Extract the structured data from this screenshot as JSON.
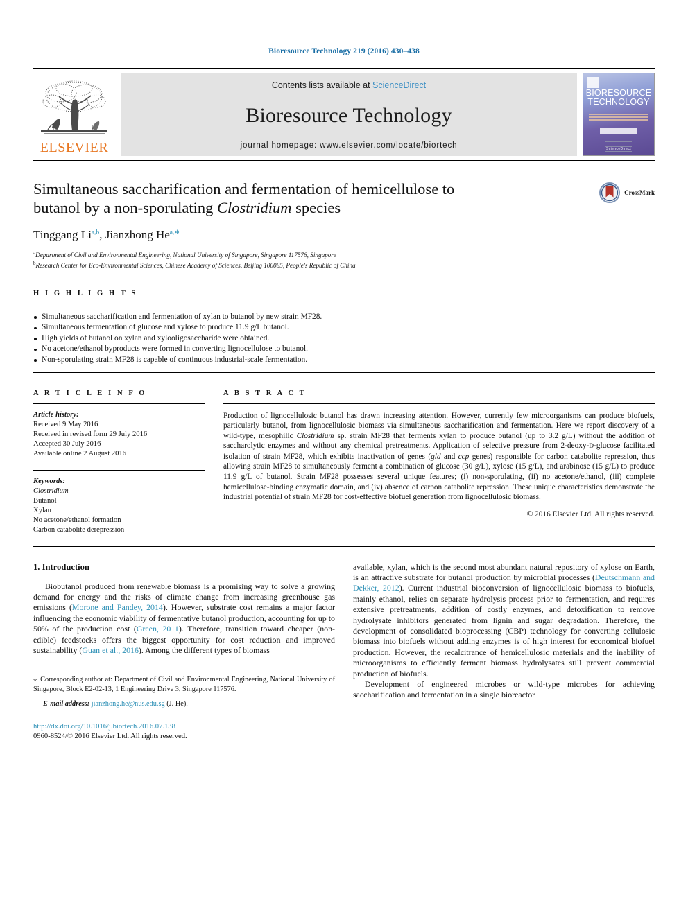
{
  "running_head": "Bioresource Technology 219 (2016) 430–438",
  "masthead": {
    "publisher_logo_text": "ELSEVIER",
    "contents_prefix": "Contents lists available at ",
    "contents_link": "ScienceDirect",
    "journal_name": "Bioresource Technology",
    "homepage_label": "journal homepage: www.elsevier.com/locate/biortech",
    "cover": {
      "line1": "BIORESOURCE",
      "line2": "TECHNOLOGY",
      "footer": "ScienceDirect"
    }
  },
  "article": {
    "title_line1": "Simultaneous saccharification and fermentation of hemicellulose to",
    "title_line2_a": "butanol by a non-sporulating ",
    "title_line2_italic": "Clostridium",
    "title_line2_b": " species",
    "crossmark_label": "CrossMark",
    "authors": [
      {
        "name": "Tinggang Li",
        "sup": "a,b",
        "sep": ", "
      },
      {
        "name": "Jianzhong He",
        "sup": "a,∗",
        "sep": ""
      }
    ],
    "affiliations": [
      {
        "marker": "a",
        "text": "Department of Civil and Environmental Engineering, National University of Singapore, Singapore 117576, Singapore"
      },
      {
        "marker": "b",
        "text": "Research Center for Eco-Environmental Sciences, Chinese Academy of Sciences, Beijing 100085, People's Republic of China"
      }
    ]
  },
  "highlights": {
    "heading": "H I G H L I G H T S",
    "items": [
      "Simultaneous saccharification and fermentation of xylan to butanol by new strain MF28.",
      "Simultaneous fermentation of glucose and xylose to produce 11.9 g/L butanol.",
      "High yields of butanol on xylan and xylooligosaccharide were obtained.",
      "No acetone/ethanol byproducts were formed in converting lignocellulose to butanol.",
      "Non-sporulating strain MF28 is capable of continuous industrial-scale fermentation."
    ]
  },
  "article_info": {
    "heading": "A R T I C L E   I N F O",
    "history_label": "Article history:",
    "history": [
      "Received 9 May 2016",
      "Received in revised form 29 July 2016",
      "Accepted 30 July 2016",
      "Available online 2 August 2016"
    ],
    "keywords_label": "Keywords:",
    "keywords": [
      "Clostridium",
      "Butanol",
      "Xylan",
      "No acetone/ethanol formation",
      "Carbon catabolite derepression"
    ]
  },
  "abstract": {
    "heading": "A B S T R A C T",
    "p1": "Production of lignocellulosic butanol has drawn increasing attention. However, currently few microorganisms can produce biofuels, particularly butanol, from lignocellulosic biomass via simultaneous saccharification and fermentation. Here we report discovery of a wild-type, mesophilic ",
    "italic1": "Clostridium",
    "p2": " sp. strain MF28 that ferments xylan to produce butanol (up to 3.2 g/L) without the addition of saccharolytic enzymes and without any chemical pretreatments. Application of selective pressure from 2-deoxy-",
    "smallcap_d": "D",
    "p3": "-glucose facilitated isolation of strain MF28, which exhibits inactivation of genes (",
    "italic2": "gld",
    "p4": " and ",
    "italic3": "ccp",
    "p5": " genes) responsible for carbon catabolite repression, thus allowing strain MF28 to simultaneously ferment a combination of glucose (30 g/L), xylose (15 g/L), and arabinose (15 g/L) to produce 11.9 g/L of butanol. Strain MF28 possesses several unique features; (i) non-sporulating, (ii) no acetone/ethanol, (iii) complete hemicellulose-binding enzymatic domain, and (iv) absence of carbon catabolite repression. These unique characteristics demonstrate the industrial potential of strain MF28 for cost-effective biofuel generation from lignocellulosic biomass.",
    "copyright": "© 2016 Elsevier Ltd. All rights reserved."
  },
  "introduction": {
    "heading": "1. Introduction",
    "left_p1_a": "Biobutanol produced from renewable biomass is a promising way to solve a growing demand for energy and the risks of climate change from increasing greenhouse gas emissions (",
    "left_ref1": "Morone and Pandey, 2014",
    "left_p1_b": "). However, substrate cost remains a major factor influencing the economic viability of fermentative butanol production, accounting for up to 50% of the production cost (",
    "left_ref2": "Green, 2011",
    "left_p1_c": "). Therefore, transition toward cheaper (non-edible) feedstocks offers the biggest opportunity for cost reduction and improved sustainability (",
    "left_ref3": "Guan et al., 2016",
    "left_p1_d": "). Among the different types of biomass",
    "right_p1_a": "available, xylan, which is the second most abundant natural repository of xylose on Earth, is an attractive substrate for butanol production by microbial processes (",
    "right_ref1": "Deutschmann and Dekker, 2012",
    "right_p1_b": "). Current industrial bioconversion of lignocellulosic biomass to biofuels, mainly ethanol, relies on separate hydrolysis process prior to fermentation, and requires extensive pretreatments, addition of costly enzymes, and detoxification to remove hydrolysate inhibitors generated from lignin and sugar degradation. Therefore, the development of consolidated bioprocessing (CBP) technology for converting cellulosic biomass into biofuels without adding enzymes is of high interest for economical biofuel production. However, the recalcitrance of hemicellulosic materials and the inability of microorganisms to efficiently ferment biomass hydrolysates still prevent commercial production of biofuels.",
    "right_p2": "Development of engineered microbes or wild-type microbes for achieving saccharification and fermentation in a single bioreactor"
  },
  "footnotes": {
    "corresponding_star": "⁎",
    "corresponding_text": " Corresponding author at: Department of Civil and Environmental Engineering, National University of Singapore, Block E2-02-13, 1 Engineering Drive 3, Singapore 117576.",
    "email_label": "E-mail address:",
    "email": "jianzhong.he@nus.edu.sg",
    "email_person": " (J. He).",
    "doi": "http://dx.doi.org/10.1016/j.biortech.2016.07.138",
    "issn_line": "0960-8524/© 2016 Elsevier Ltd. All rights reserved."
  },
  "colors": {
    "link": "#2b8fb5",
    "runhead": "#1a6ea5",
    "elsevier_orange": "#E87722",
    "masthead_gray": "#e3e3e3"
  }
}
